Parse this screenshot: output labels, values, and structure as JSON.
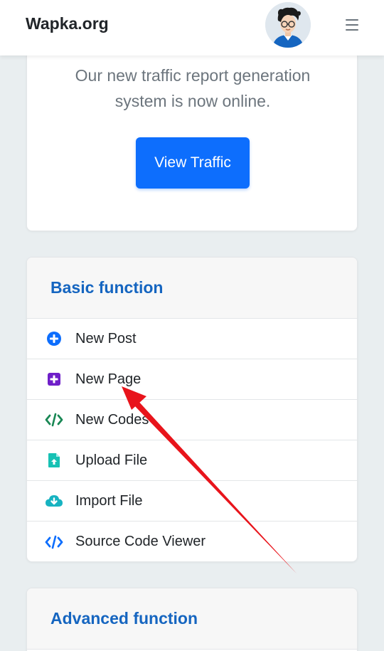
{
  "header": {
    "brand": "Wapka.org"
  },
  "traffic": {
    "message": "Our new traffic report generation system is now online.",
    "button_label": "View Traffic"
  },
  "basic": {
    "title": "Basic function",
    "items": [
      {
        "label": "New Post",
        "icon": "plus-circle-icon"
      },
      {
        "label": "New Page",
        "icon": "plus-square-icon"
      },
      {
        "label": "New Codes",
        "icon": "code-icon"
      },
      {
        "label": "Upload File",
        "icon": "file-upload-icon"
      },
      {
        "label": "Import File",
        "icon": "cloud-download-icon"
      },
      {
        "label": "Source Code Viewer",
        "icon": "code-icon"
      }
    ]
  },
  "advanced": {
    "title": "Advanced function"
  },
  "colors": {
    "primary": "#0d6efd",
    "title_blue": "#1565c0",
    "purple": "#6f1fc9",
    "teal": "#17a2b8",
    "green": "#198754",
    "arrow_red": "#e8141b"
  }
}
